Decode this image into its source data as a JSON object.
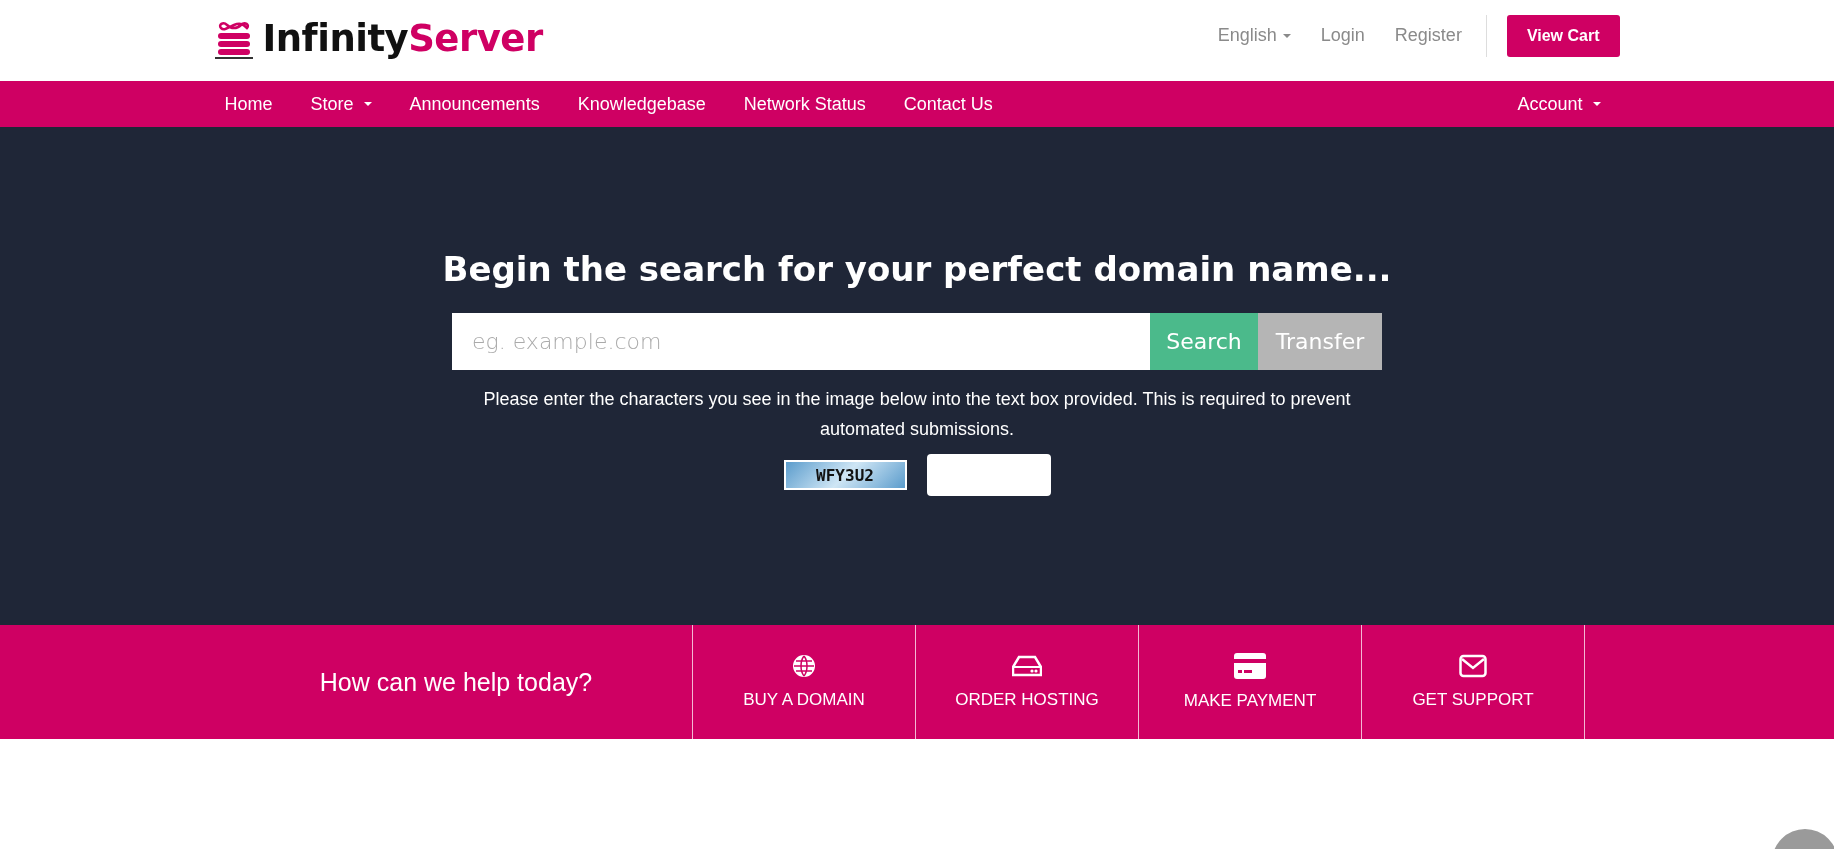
{
  "brand": {
    "name_part_1": "Infinity",
    "name_part_2": "Server"
  },
  "top_links": [
    {
      "label": "English",
      "kind": "dropdown"
    },
    {
      "label": "Login",
      "kind": "link"
    },
    {
      "label": "Register",
      "kind": "link"
    }
  ],
  "cart_button": "View Cart",
  "nav": {
    "items": [
      {
        "label": "Home",
        "dropdown": false
      },
      {
        "label": "Store",
        "dropdown": true
      },
      {
        "label": "Announcements",
        "dropdown": false
      },
      {
        "label": "Knowledgebase",
        "dropdown": false
      },
      {
        "label": "Network Status",
        "dropdown": false
      },
      {
        "label": "Contact Us",
        "dropdown": false
      }
    ],
    "account": {
      "label": "Account",
      "dropdown": true
    }
  },
  "hero": {
    "title": "Begin the search for your perfect domain name...",
    "search": {
      "placeholder": "eg. example.com"
    },
    "buttons": [
      {
        "label": "Search",
        "kind": "primary"
      },
      {
        "label": "Transfer",
        "kind": "secondary"
      }
    ],
    "captcha_note": "Please enter the characters you see in the image below into the text box provided. This is required to prevent automated submissions.",
    "captcha_code": "WFY3U2"
  },
  "help": {
    "title": "How can we help today?",
    "actions": [
      {
        "label": "BUY A DOMAIN",
        "kind": "globe"
      },
      {
        "label": "ORDER HOSTING",
        "kind": "server"
      },
      {
        "label": "MAKE PAYMENT",
        "kind": "card"
      },
      {
        "label": "GET SUPPORT",
        "kind": "mail"
      }
    ]
  }
}
